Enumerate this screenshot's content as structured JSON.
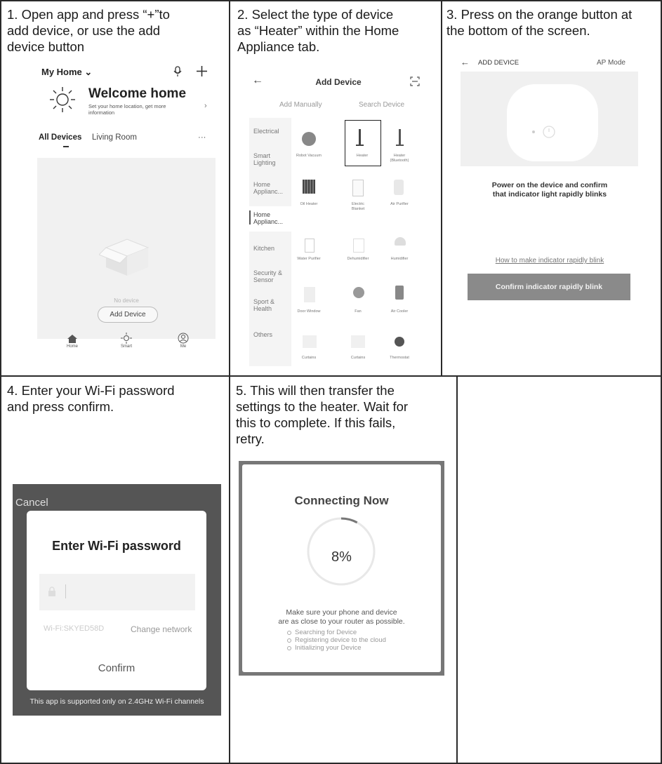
{
  "steps": [
    {
      "text": "1.  Open app and press “+”to\n      add device, or use the add\n      device button"
    },
    {
      "text": "2.  Select the type of device\n      as “Heater” within the Home\n      Appliance tab."
    },
    {
      "text": "3.  Press on the orange button at\n     the bottom of the screen."
    },
    {
      "text": "4. Enter your Wi-Fi password\nand press confirm."
    },
    {
      "text": "5. This will then transfer the\n    settings to the heater. Wait for\n    this to complete. If this fails,\n    retry."
    }
  ],
  "screen1": {
    "home_title": "My Home ⌄",
    "welcome": "Welcome home",
    "welcome_sub": "Set your home location, get more\ninformation",
    "tab_all": "All Devices",
    "tab_living": "Living Room",
    "more": "···",
    "no_device": "No device",
    "add_device": "Add Device",
    "nav": [
      "Home",
      "Smart",
      "Me"
    ],
    "icons": {
      "mic": "microphone-icon",
      "plus": "plus-icon",
      "sun": "sun-icon",
      "box": "empty-box-icon"
    }
  },
  "screen2": {
    "title": "Add Device",
    "tab_manual": "Add Manually",
    "tab_search": "Search Device",
    "categories": [
      "Electrical",
      "Smart\nLighting",
      "Home\nApplianc...",
      "Home\nApplianc...",
      "Kitchen",
      "Security &\nSensor",
      "Sport &\nHealth",
      "Others"
    ],
    "devices": [
      "Robot Vacuum",
      "Heater",
      "Heater\n(Bluetooth)",
      "Oil Heater",
      "Electric\nBlanket",
      "Air Purifier",
      "Water Purifier",
      "Dehumidifier",
      "Humidifier",
      "Door Window",
      "Fan",
      "Air Cooler",
      "Curtains",
      "Curtains",
      "Thermostat"
    ],
    "selected_device": "Heater"
  },
  "screen3": {
    "title": "ADD DEVICE",
    "mode": "AP Mode",
    "message": "Power on the device and confirm\nthat indicator light rapidly blinks",
    "link": "How to make indicator rapidly blink",
    "button": "Confirm indicator rapidly blink"
  },
  "screen4": {
    "cancel": "Cancel",
    "title": "Enter Wi-Fi password",
    "ssid": "Wi-Fi:SKYED58D",
    "change_network": "Change network",
    "confirm": "Confirm",
    "note": "This app is supported only on 2.4GHz Wi-Fi channels"
  },
  "screen5": {
    "title": "Connecting Now",
    "progress_label": "8%",
    "progress_fraction": 0.08,
    "tip": "Make sure your phone and device\nare as close to your router as possible.",
    "steps": [
      "Searching for Device",
      "Registering device to the cloud",
      "Initializing your Device"
    ]
  }
}
